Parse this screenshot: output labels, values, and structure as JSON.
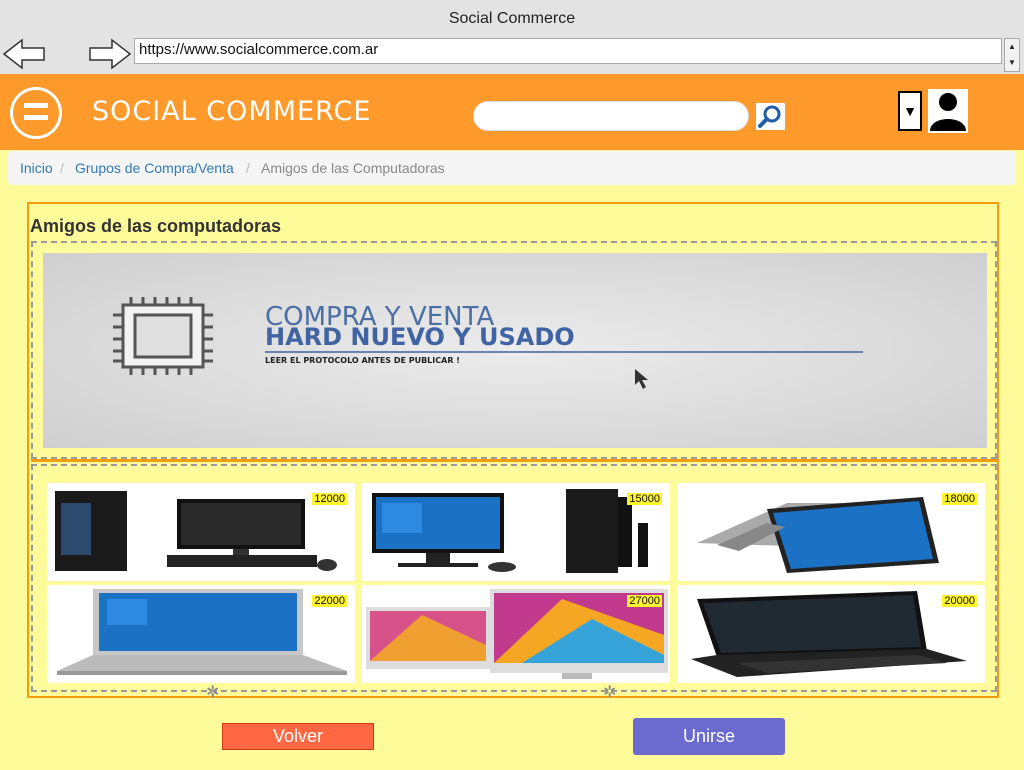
{
  "browser": {
    "title": "Social Commerce",
    "url": "https://www.socialcommerce.com.ar"
  },
  "header": {
    "brand": "SOCIAL COMMERCE",
    "search_value": "",
    "dropdown_glyph": "▼"
  },
  "breadcrumb": {
    "items": [
      "Inicio",
      "Grupos de Compra/Venta",
      "Amigos de las Computadoras"
    ],
    "separator": "/"
  },
  "group": {
    "title": "Amigos de las computadoras",
    "banner": {
      "line1": "COMPRA Y VENTA",
      "line2": "HARD NUEVO Y USADO",
      "line3": "LEER EL PROTOCOLO ANTES DE PUBLICAR !"
    },
    "products": [
      {
        "price": "12000",
        "image": "gaming-desktop"
      },
      {
        "price": "15000",
        "image": "desktop-computer"
      },
      {
        "price": "18000",
        "image": "convertible-laptop"
      },
      {
        "price": "22000",
        "image": "silver-laptop"
      },
      {
        "price": "27000",
        "image": "all-in-one-imac"
      },
      {
        "price": "20000",
        "image": "gaming-laptop"
      }
    ]
  },
  "actions": {
    "back_label": "Volver",
    "join_label": "Unirse"
  },
  "colors": {
    "page_bg": "#fefb9a",
    "header_bg": "#fd9a2b",
    "accent_border": "#f39c12",
    "back_button": "#ff6842",
    "join_button": "#6a6acf",
    "price_tag": "#fdf32e"
  }
}
